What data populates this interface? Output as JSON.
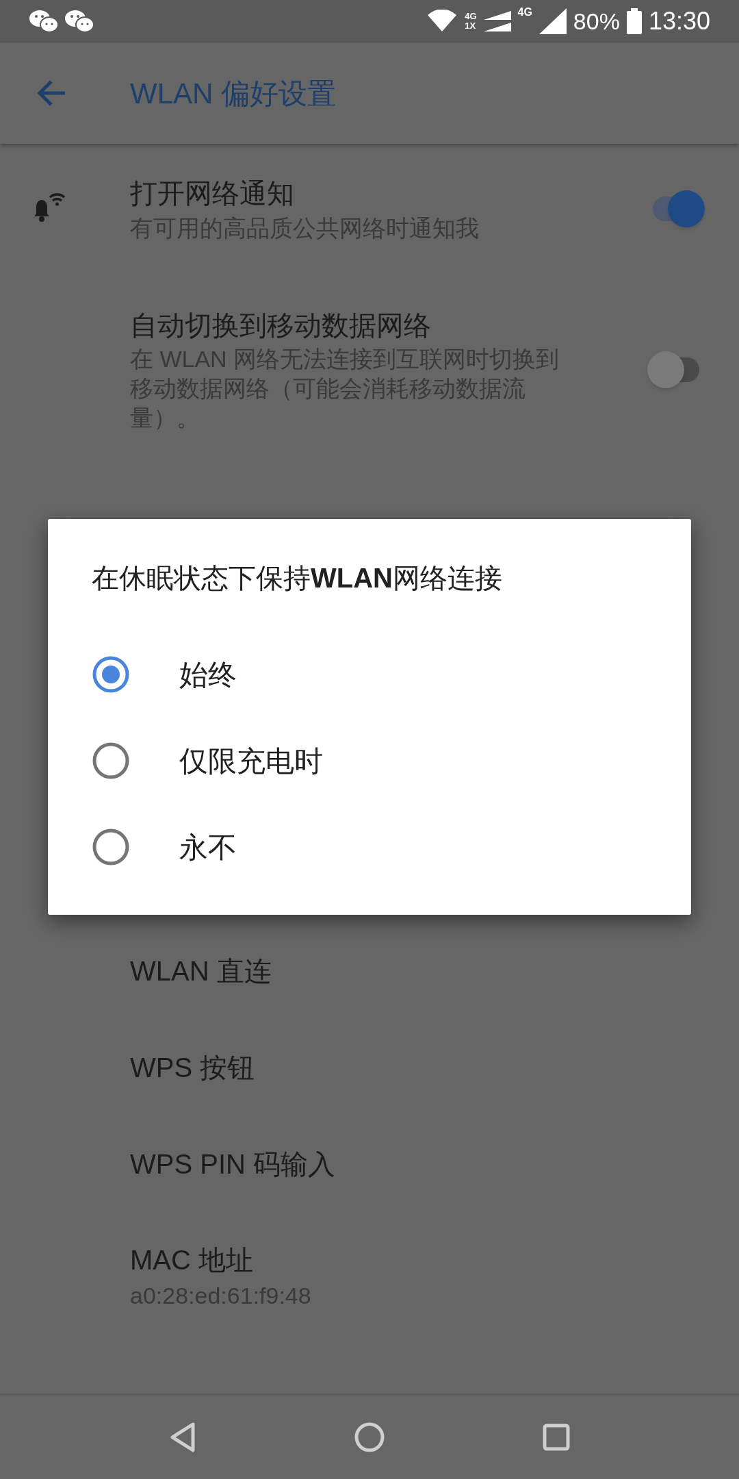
{
  "status_bar": {
    "network_labels": [
      "4G",
      "1X",
      "4G"
    ],
    "battery": "80%",
    "time": "13:30"
  },
  "app_bar": {
    "title": "WLAN 偏好设置"
  },
  "settings": [
    {
      "kind": "icon_switch",
      "title": "打开网络通知",
      "summary": "有可用的高品质公共网络时通知我",
      "on": true
    },
    {
      "kind": "switch",
      "title": "自动切换到移动数据网络",
      "summary": "在 WLAN 网络无法连接到互联网时切换到移动数据网络（可能会消耗移动数据流量）。",
      "on": false
    },
    {
      "kind": "gap"
    },
    {
      "kind": "link",
      "title": "WLAN 直连"
    },
    {
      "kind": "link",
      "title": "WPS 按钮"
    },
    {
      "kind": "link",
      "title": "WPS PIN 码输入"
    },
    {
      "kind": "info",
      "title": "MAC 地址",
      "summary": "a0:28:ed:61:f9:48"
    }
  ],
  "dialog": {
    "title": "在休眠状态下保持**WLAN**网络连接",
    "options": [
      {
        "label": "始终",
        "selected": true
      },
      {
        "label": "仅限充电时",
        "selected": false
      },
      {
        "label": "永不",
        "selected": false
      }
    ]
  }
}
